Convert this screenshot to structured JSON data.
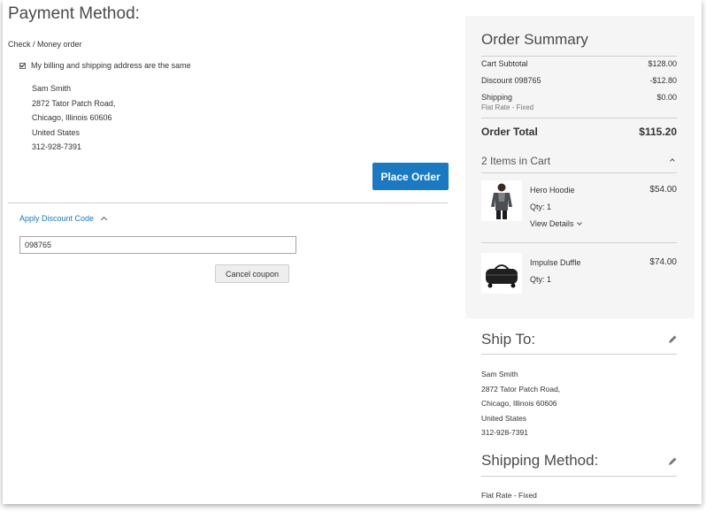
{
  "payment": {
    "title": "Payment Method:",
    "option": "Check / Money order",
    "same_address_label": "My billing and shipping address are the same",
    "address": [
      "Sam Smith",
      "2872 Tator Patch Road,",
      "Chicago, Illinois 60606",
      "United States",
      "312-928-7391"
    ],
    "place_order_label": "Place Order",
    "discount_toggle_label": "Apply Discount Code",
    "discount_value": "098765",
    "cancel_coupon_label": "Cancel coupon"
  },
  "summary": {
    "title": "Order Summary",
    "subtotal_label": "Cart Subtotal",
    "subtotal_value": "$128.00",
    "discount_label": "Discount 098765",
    "discount_value": "-$12.80",
    "shipping_label": "Shipping",
    "shipping_sub": "Flat Rate - Fixed",
    "shipping_value": "$0.00",
    "total_label": "Order Total",
    "total_value": "$115.20",
    "items_header": "2 Items in Cart",
    "items": [
      {
        "name": "Hero Hoodie",
        "qty": "Qty: 1",
        "price": "$54.00",
        "details": "View Details"
      },
      {
        "name": "Impulse Duffle",
        "qty": "Qty: 1",
        "price": "$74.00"
      }
    ]
  },
  "ship_to": {
    "title": "Ship To:",
    "address": [
      "Sam Smith",
      "2872 Tator Patch Road,",
      "Chicago, Illinois 60606",
      "United States",
      "312-928-7391"
    ]
  },
  "shipping_method": {
    "title": "Shipping Method:",
    "value": "Flat Rate - Fixed"
  },
  "colors": {
    "accent": "#1979c3",
    "summary_bg": "#f5f5f5"
  }
}
